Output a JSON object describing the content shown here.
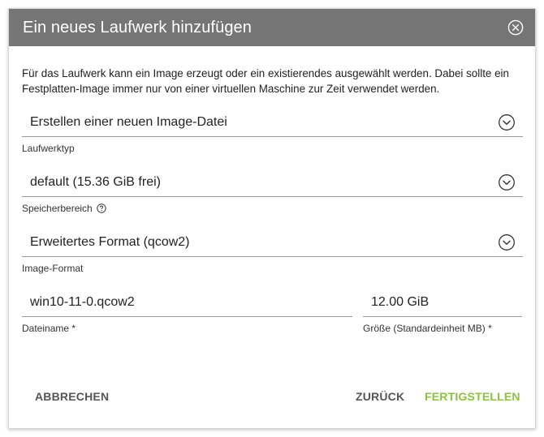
{
  "dialog": {
    "title": "Ein neues Laufwerk hinzufügen",
    "description": "Für das Laufwerk kann ein Image erzeugt oder ein existierendes ausgewählt werden. Dabei sollte ein Festplatten-Image immer nur von einer virtuellen Maschine zur Zeit verwendet werden."
  },
  "fields": {
    "drive_type": {
      "value": "Erstellen einer neuen Image-Datei",
      "label": "Laufwerktyp"
    },
    "storage": {
      "value": "default (15.36 GiB frei)",
      "label": "Speicherbereich"
    },
    "image_format": {
      "value": "Erweitertes Format (qcow2)",
      "label": "Image-Format"
    },
    "filename": {
      "value": "win10-11-0.qcow2",
      "label": "Dateiname *"
    },
    "size": {
      "value": "12.00 GiB",
      "label": "Größe (Standardeinheit MB) *"
    }
  },
  "buttons": {
    "cancel": "ABBRECHEN",
    "back": "ZURÜCK",
    "finish": "FERTIGSTELLEN"
  },
  "colors": {
    "titlebar": "#757575",
    "accent_green": "#8ac33b",
    "button_gray": "#555555"
  },
  "icons": {
    "close": "close-circle-icon",
    "dropdown": "chevron-down-circle-icon",
    "help": "help-circle-icon"
  }
}
